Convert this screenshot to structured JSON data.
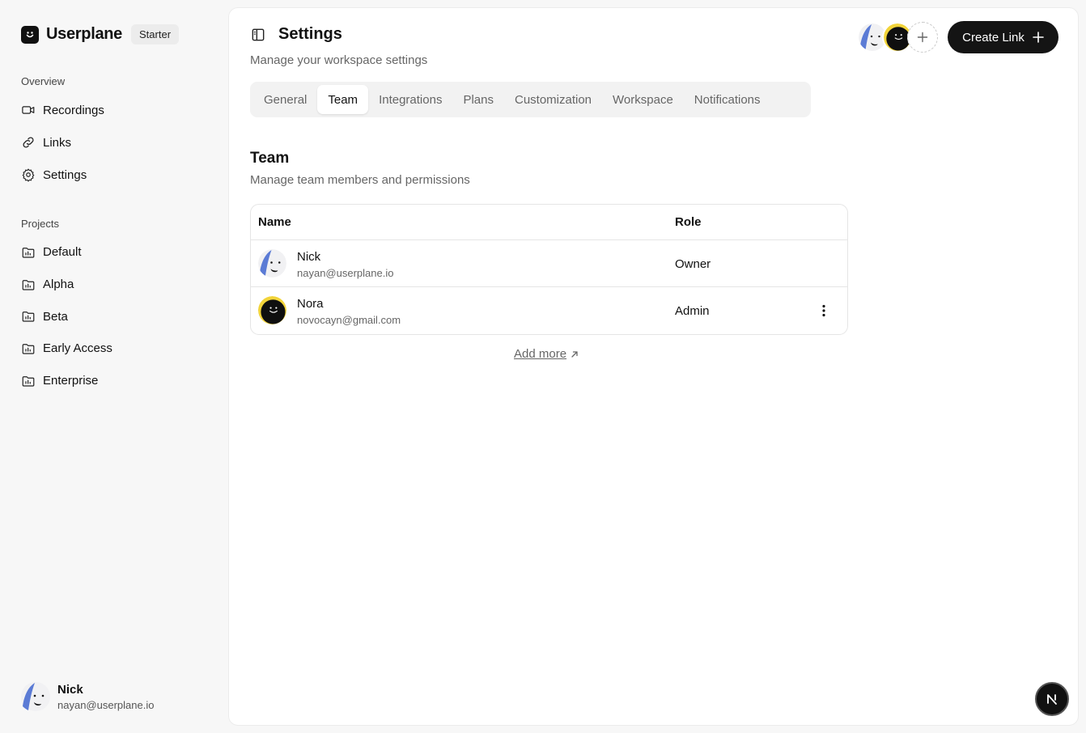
{
  "brand": {
    "name": "Userplane",
    "plan_badge": "Starter"
  },
  "sidebar": {
    "overview_label": "Overview",
    "overview_items": [
      {
        "label": "Recordings",
        "icon": "video-icon"
      },
      {
        "label": "Links",
        "icon": "link-icon"
      },
      {
        "label": "Settings",
        "icon": "gear-icon"
      }
    ],
    "projects_label": "Projects",
    "projects": [
      {
        "label": "Default",
        "icon": "folder-chart-icon"
      },
      {
        "label": "Alpha",
        "icon": "folder-chart-icon"
      },
      {
        "label": "Beta",
        "icon": "folder-chart-icon"
      },
      {
        "label": "Early Access",
        "icon": "folder-chart-icon"
      },
      {
        "label": "Enterprise",
        "icon": "folder-chart-icon"
      }
    ],
    "user": {
      "name": "Nick",
      "email": "nayan@userplane.io"
    }
  },
  "header": {
    "title": "Settings",
    "subtitle": "Manage your workspace settings",
    "create_button": "Create Link"
  },
  "tabs": [
    {
      "label": "General",
      "active": false
    },
    {
      "label": "Team",
      "active": true
    },
    {
      "label": "Integrations",
      "active": false
    },
    {
      "label": "Plans",
      "active": false
    },
    {
      "label": "Customization",
      "active": false
    },
    {
      "label": "Workspace",
      "active": false
    },
    {
      "label": "Notifications",
      "active": false
    }
  ],
  "team": {
    "title": "Team",
    "subtitle": "Manage team members and permissions",
    "columns": {
      "name": "Name",
      "role": "Role"
    },
    "members": [
      {
        "name": "Nick",
        "email": "nayan@userplane.io",
        "role": "Owner"
      },
      {
        "name": "Nora",
        "email": "novocayn@gmail.com",
        "role": "Admin"
      }
    ],
    "add_more": "Add more"
  },
  "fab": {
    "letter": "N"
  },
  "colors": {
    "accent": "#141414",
    "avatar_blue": "#5b7bd5",
    "avatar_yellow": "#f2d43a"
  }
}
